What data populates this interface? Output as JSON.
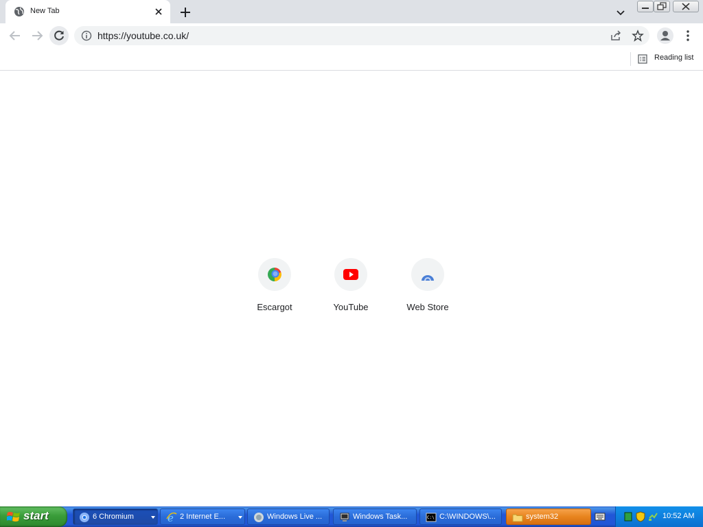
{
  "tab": {
    "title": "New Tab"
  },
  "omnibox": {
    "url": "https://youtube.co.uk/"
  },
  "bookmarks": {
    "reading_list": "Reading list"
  },
  "shortcuts": [
    {
      "label": "Escargot",
      "icon": "escargot-icon"
    },
    {
      "label": "YouTube",
      "icon": "youtube-icon"
    },
    {
      "label": "Web Store",
      "icon": "web-store-icon"
    }
  ],
  "taskbar": {
    "start": "start",
    "buttons": [
      {
        "label": "6 Chromium",
        "icon": "chromium-icon"
      },
      {
        "label": "2 Internet E...",
        "icon": "internet-explorer-icon"
      },
      {
        "label": "Windows Live ...",
        "icon": "windows-live-icon"
      },
      {
        "label": "Windows Task...",
        "icon": "task-manager-icon"
      },
      {
        "label": "C:\\WINDOWS\\...",
        "icon": "command-prompt-icon"
      },
      {
        "label": "system32",
        "icon": "folder-icon"
      }
    ],
    "clock": "10:52 AM"
  },
  "colors": {
    "tabstrip": "#dee1e6",
    "taskbar": "#2157d7",
    "start": "#3a9d3a",
    "youtube": "#ff0000"
  }
}
